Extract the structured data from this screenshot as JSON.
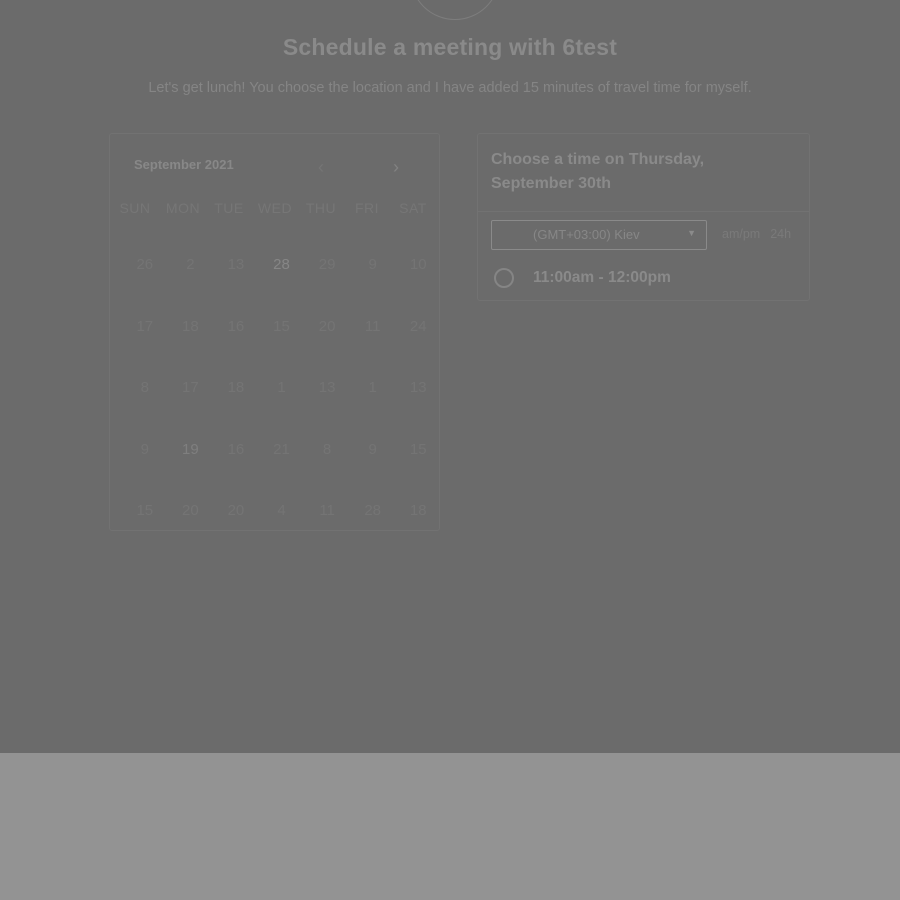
{
  "header": {
    "title": "Schedule a meeting with 6test",
    "subtitle": "Let's get lunch! You choose the location and I have added 15 minutes of travel time for myself."
  },
  "calendar": {
    "month": "September 2021",
    "prev_icon": "chevron-left-icon",
    "next_icon": "chevron-right-icon",
    "weekdays": [
      "SUN",
      "MON",
      "TUE",
      "WED",
      "THU",
      "FRI",
      "SAT"
    ],
    "weeks": [
      [
        "26",
        "2",
        "13",
        "28",
        "29",
        "9",
        "10"
      ],
      [
        "17",
        "18",
        "16",
        "15",
        "20",
        "11",
        "24"
      ],
      [
        "8",
        "17",
        "18",
        "1",
        "13",
        "1",
        "13"
      ],
      [
        "9",
        "19",
        "16",
        "21",
        "8",
        "9",
        "15"
      ],
      [
        "15",
        "20",
        "20",
        "4",
        "11",
        "28",
        "18"
      ]
    ]
  },
  "time_panel": {
    "heading": "Choose a time on Thursday, September 30th",
    "timezone": "(GMT+03:00) Kiev",
    "format_ampm": "am/pm",
    "format_24h": "24h",
    "slots": [
      "11:00am - 12:00pm"
    ]
  }
}
